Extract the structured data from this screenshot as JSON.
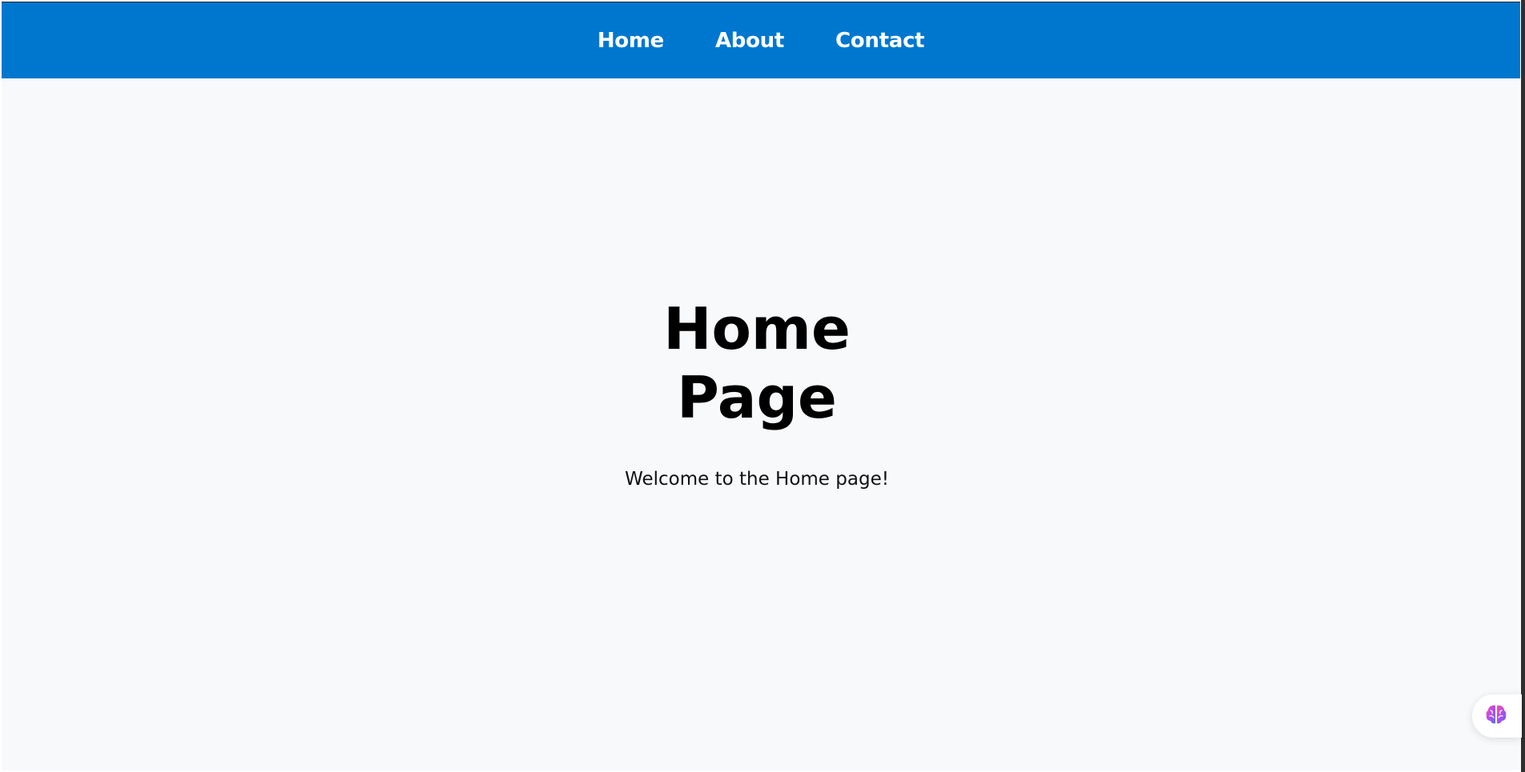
{
  "nav": {
    "items": [
      {
        "label": "Home"
      },
      {
        "label": "About"
      },
      {
        "label": "Contact"
      }
    ],
    "background_color": "#0077cf"
  },
  "main": {
    "title_line1": "Home",
    "title_line2": "Page",
    "welcome_text": "Welcome to the Home page!"
  },
  "assistant_widget": {
    "icon": "brain-icon"
  },
  "colors": {
    "page_background": "#f7f9fb",
    "nav_text": "#ffffff"
  }
}
